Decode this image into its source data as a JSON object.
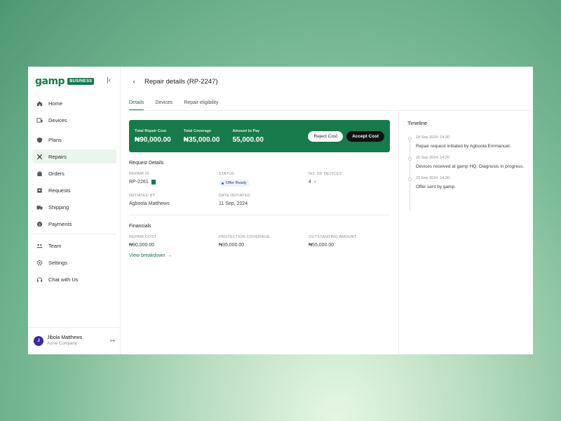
{
  "brand": {
    "logo": "gamp",
    "badge": "BUSINESS"
  },
  "sidebar": {
    "items": [
      {
        "label": "Home",
        "icon": "home-icon"
      },
      {
        "label": "Devices",
        "icon": "devices-icon"
      },
      {
        "label": "Plans",
        "icon": "shield-icon"
      },
      {
        "label": "Repairs",
        "icon": "tools-icon",
        "active": true
      },
      {
        "label": "Orders",
        "icon": "orders-icon"
      },
      {
        "label": "Requests",
        "icon": "requests-icon"
      },
      {
        "label": "Shipping",
        "icon": "truck-icon"
      },
      {
        "label": "Payments",
        "icon": "payment-icon"
      },
      {
        "label": "Team",
        "icon": "team-icon"
      },
      {
        "label": "Settings",
        "icon": "gear-icon"
      },
      {
        "label": "Chat with Us",
        "icon": "headset-icon"
      }
    ]
  },
  "user": {
    "initial": "J",
    "name": "Jibola Matthews",
    "org": "Acme Company"
  },
  "header": {
    "title": "Repair details (RP-2247)"
  },
  "tabs": [
    {
      "label": "Details",
      "active": true
    },
    {
      "label": "Devices"
    },
    {
      "label": "Repair eligibility"
    }
  ],
  "banner": {
    "total_repair_cost_label": "Total Repair Cost",
    "total_repair_cost": "₦90,000.00",
    "total_coverage_label": "Total Coverage",
    "total_coverage": "₦35,000.00",
    "amount_to_pay_label": "Amount to Pay",
    "amount_to_pay": "55,000.00",
    "reject_label": "Reject Cost",
    "accept_label": "Accept Cost"
  },
  "request_details": {
    "title": "Request Details",
    "repair_id_label": "REPAIR ID",
    "repair_id": "RP-2261",
    "status_label": "STATUS",
    "status": "Offer Ready",
    "devices_label": "NO. OF DEVICES",
    "devices": "4",
    "initiated_by_label": "INITIATED BY",
    "initiated_by": "Agboola Matthews",
    "date_initiated_label": "DATE INITIATED",
    "date_initiated": "11 Sep, 2024"
  },
  "financials": {
    "title": "Financials",
    "repair_cost_label": "REPAIR COST",
    "repair_cost": "₦90,000.00",
    "protection_label": "PROTECTION COVERAGE",
    "protection": "₦35,000.00",
    "outstanding_label": "OUTSTANDING AMOUNT",
    "outstanding": "₦55,000.00",
    "breakdown_link": "View breakdown"
  },
  "timeline": {
    "title": "Timeline",
    "items": [
      {
        "date": "18 Sep 2024, 14:30",
        "text": "Repair request initiated by Agboola Emmanuel."
      },
      {
        "date": "20 Sep 2024, 14:20",
        "text": "Devices received at gamp HQ. Diagnosis in progress."
      },
      {
        "date": "23 Sep 2024, 14:30",
        "text": "Offer sent by gamp."
      }
    ]
  },
  "colors": {
    "brand": "#177a4a",
    "active_bg": "#eaf6ec",
    "accept": "#111111",
    "status_dot": "#2a5bd7"
  }
}
